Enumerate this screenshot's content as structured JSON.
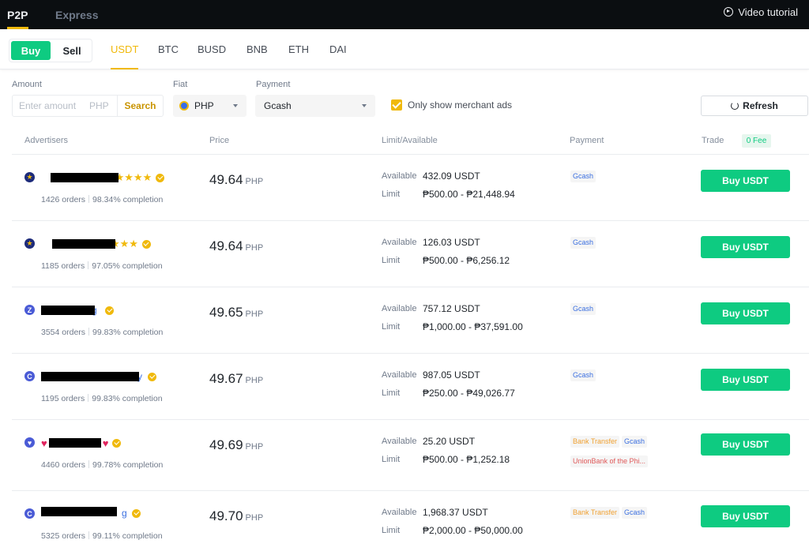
{
  "nav": {
    "p2p": "P2P",
    "express": "Express",
    "video_tutorial": "Video tutorial"
  },
  "side": {
    "buy": "Buy",
    "sell": "Sell"
  },
  "coins": [
    "USDT",
    "BTC",
    "BUSD",
    "BNB",
    "ETH",
    "DAI"
  ],
  "active_coin": "USDT",
  "filters": {
    "amount_label": "Amount",
    "amount_placeholder": "Enter amount",
    "amount_currency": "PHP",
    "search": "Search",
    "fiat_label": "Fiat",
    "fiat_value": "PHP",
    "payment_label": "Payment",
    "payment_value": "Gcash",
    "merchant_only": "Only show merchant ads",
    "refresh": "Refresh"
  },
  "table_header": {
    "advertisers": "Advertisers",
    "price": "Price",
    "limit": "Limit/Available",
    "payment": "Payment",
    "trade": "Trade",
    "fee_badge": "0 Fee"
  },
  "labels": {
    "available": "Available",
    "limit": "Limit"
  },
  "rows": [
    {
      "avatar": "★",
      "name_visible": "",
      "stars": "★★★★★",
      "orders": "1426 orders",
      "completion": "98.34% completion",
      "price": "49.64",
      "currency": "PHP",
      "available": "432.09 USDT",
      "limit": "₱500.00 - ₱21,448.94",
      "payments": [
        "Gcash"
      ],
      "action": "Buy USDT"
    },
    {
      "avatar": "★",
      "name_visible": "",
      "stars": "★★★",
      "orders": "1185 orders",
      "completion": "97.05% completion",
      "price": "49.64",
      "currency": "PHP",
      "available": "126.03 USDT",
      "limit": "₱500.00 - ₱6,256.12",
      "payments": [
        "Gcash"
      ],
      "action": "Buy USDT"
    },
    {
      "avatar": "Z",
      "name_visible": "g",
      "orders": "3554 orders",
      "completion": "99.83% completion",
      "price": "49.65",
      "currency": "PHP",
      "available": "757.12 USDT",
      "limit": "₱1,000.00 - ₱37,591.00",
      "payments": [
        "Gcash"
      ],
      "action": "Buy USDT"
    },
    {
      "avatar": "C",
      "name_visible": "y",
      "orders": "1195 orders",
      "completion": "99.83% completion",
      "price": "49.67",
      "currency": "PHP",
      "available": "987.05 USDT",
      "limit": "₱250.00 - ₱49,026.77",
      "payments": [
        "Gcash"
      ],
      "action": "Buy USDT"
    },
    {
      "avatar": "♥",
      "name_visible": "",
      "orders": "4460 orders",
      "completion": "99.78% completion",
      "price": "49.69",
      "currency": "PHP",
      "available": "25.20 USDT",
      "limit": "₱500.00 - ₱1,252.18",
      "payments": [
        "Bank Transfer",
        "Gcash",
        "UnionBank of the Phi..."
      ],
      "action": "Buy USDT"
    },
    {
      "avatar": "C",
      "name_visible": "g",
      "orders": "5325 orders",
      "completion": "99.11% completion",
      "price": "49.70",
      "currency": "PHP",
      "available": "1,968.37 USDT",
      "limit": "₱2,000.00 - ₱50,000.00",
      "payments": [
        "Bank Transfer",
        "Gcash"
      ],
      "action": "Buy USDT"
    }
  ],
  "colors": {
    "brand": "#f0b90b",
    "buy_green": "#0ecb81",
    "topbar": "#0b0e11",
    "gcash_tag": "#3b6fe0",
    "bank_tag": "#f0a030"
  }
}
